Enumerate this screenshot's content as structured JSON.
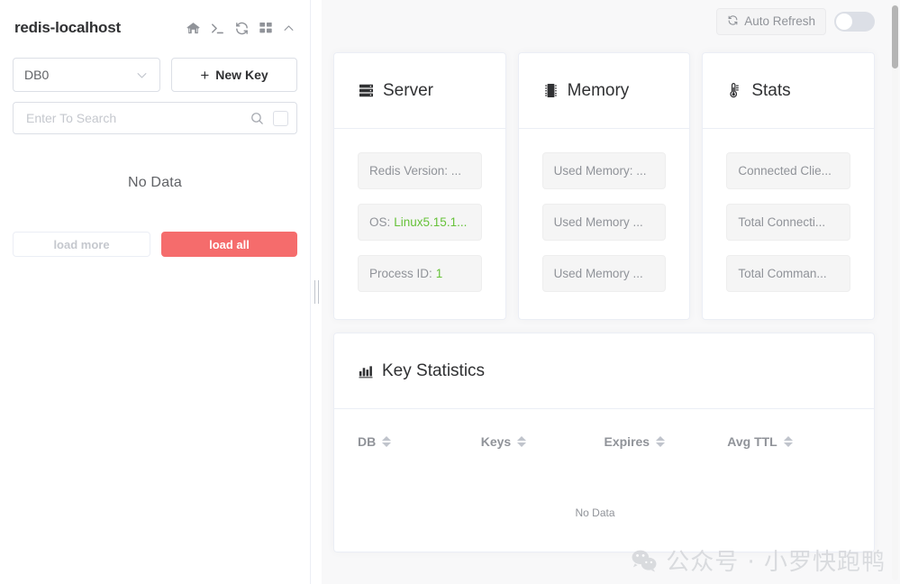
{
  "sidebar": {
    "connection_title": "redis-localhost",
    "header_icons": [
      {
        "name": "home-icon",
        "glyph": "home"
      },
      {
        "name": "terminal-icon",
        "glyph": "terminal"
      },
      {
        "name": "refresh-icon",
        "glyph": "refresh"
      },
      {
        "name": "grid-icon",
        "glyph": "grid"
      },
      {
        "name": "chevron-up-icon",
        "glyph": "chevron-up"
      }
    ],
    "db_select": {
      "value": "DB0",
      "icon": "chevron-down-icon"
    },
    "new_key_button": {
      "label": "New Key",
      "icon": "plus-icon"
    },
    "search": {
      "placeholder": "Enter To Search",
      "value": "",
      "icon": "search-icon",
      "checkbox_checked": false
    },
    "empty_text": "No Data",
    "load_more_label": "load more",
    "load_all_label": "load all",
    "load_all_color": "#f56c6c"
  },
  "toolbar": {
    "auto_refresh_label": "Auto Refresh",
    "auto_refresh_icon": "refresh-icon",
    "auto_refresh_enabled": false
  },
  "cards": [
    {
      "id": "server",
      "title": "Server",
      "icon": "server-icon",
      "items": [
        {
          "label": "Redis Version: ...",
          "value": ""
        },
        {
          "label": "OS:",
          "value": "Linux5.15.1..."
        },
        {
          "label": "Process ID:",
          "value": "1"
        }
      ]
    },
    {
      "id": "memory",
      "title": "Memory",
      "icon": "memory-chip-icon",
      "items": [
        {
          "label": "Used Memory: ...",
          "value": ""
        },
        {
          "label": "Used Memory ...",
          "value": ""
        },
        {
          "label": "Used Memory ...",
          "value": ""
        }
      ]
    },
    {
      "id": "stats",
      "title": "Stats",
      "icon": "thermometer-icon",
      "items": [
        {
          "label": "Connected Clie...",
          "value": ""
        },
        {
          "label": "Total Connecti...",
          "value": ""
        },
        {
          "label": "Total Comman...",
          "value": ""
        }
      ]
    }
  ],
  "key_statistics": {
    "title": "Key Statistics",
    "icon": "bar-chart-icon",
    "columns": [
      {
        "label": "DB",
        "sortable": true
      },
      {
        "label": "Keys",
        "sortable": true
      },
      {
        "label": "Expires",
        "sortable": true
      },
      {
        "label": "Avg TTL",
        "sortable": true
      }
    ],
    "rows": [],
    "empty_text": "No Data"
  },
  "watermark": {
    "text": "公众号 · 小罗快跑鸭",
    "icon": "wechat-icon"
  },
  "colors": {
    "accent_red": "#f56c6c",
    "value_green": "#67c23a",
    "muted": "#909399",
    "panel_bg": "#f8f8f9"
  }
}
